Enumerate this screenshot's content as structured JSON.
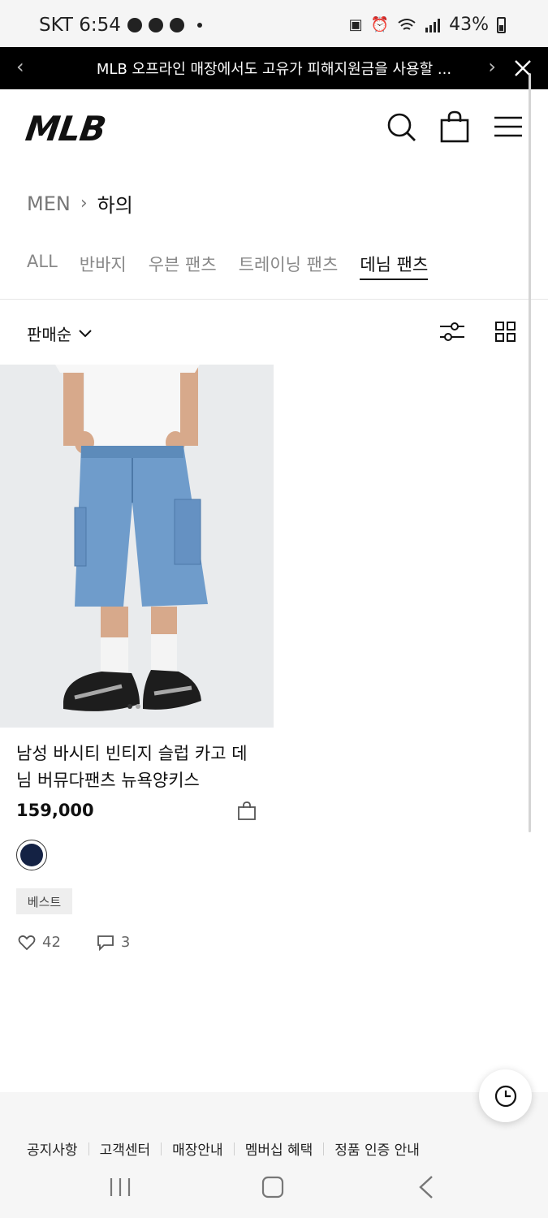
{
  "status_bar": {
    "carrier_time": "SKT 6:54",
    "battery": "43%",
    "icons": [
      "baseball-icon",
      "moon-icon",
      "baseball-icon",
      "notification-dot",
      "battery-saver-icon",
      "alarm-icon",
      "wifi-icon",
      "signal-icon",
      "battery-icon"
    ]
  },
  "banner": {
    "text": "MLB 오프라인 매장에서도 고유가 피해지원금을 사용할 ...",
    "prev_icon": "chevron-left-icon",
    "next_icon": "chevron-right-icon",
    "close_icon": "close-icon"
  },
  "header": {
    "logo": "MLB",
    "icons": [
      "search-icon",
      "shopping-bag-icon",
      "menu-icon"
    ]
  },
  "breadcrumb": {
    "parent": "MEN",
    "current": "하의"
  },
  "tabs": [
    {
      "label": "ALL"
    },
    {
      "label": "반바지"
    },
    {
      "label": "우븐 팬츠"
    },
    {
      "label": "트레이닝 팬츠"
    },
    {
      "label": "데님 팬츠",
      "active": true
    }
  ],
  "sort": {
    "label": "판매순",
    "filter_icon": "filter-sliders-icon",
    "view_icon": "grid-view-icon"
  },
  "product": {
    "name": "남성 바시티 빈티지 슬럽 카고 데님 버뮤다팬츠 뉴욕양키스",
    "price": "159,000",
    "swatch_color": "#142244",
    "badge": "베스트",
    "likes": "42",
    "reviews": "3"
  },
  "footer": {
    "links": [
      "공지사항",
      "고객센터",
      "매장안내",
      "멤버십 혜택",
      "정품 인증 안내"
    ]
  },
  "navbar": {
    "icons": [
      "recent-apps-icon",
      "home-icon",
      "back-icon"
    ]
  },
  "colors": {
    "banner_bg": "#000000",
    "accent_text": "#111111",
    "muted_text": "#888888"
  }
}
